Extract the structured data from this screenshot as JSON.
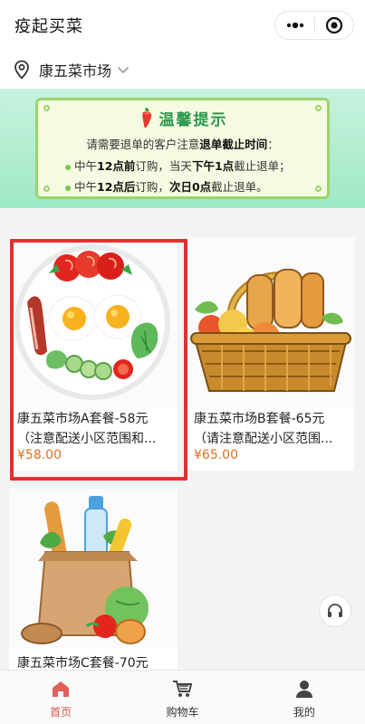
{
  "app": {
    "title": "疫起买菜"
  },
  "location": {
    "market": "康五菜市场"
  },
  "notice": {
    "title": "温馨提示",
    "line1": {
      "pre": "请需要退单的客户注意",
      "hl": "退单截止时间",
      "post": "："
    },
    "line2": {
      "a": "中午",
      "b": "12点前",
      "c": "订购，当天",
      "d": "下午1点",
      "e": "截止退单；"
    },
    "line3": {
      "a": "中午",
      "b": "12点后",
      "c": "订购，",
      "d": "次日0点",
      "e": "截止退单。"
    }
  },
  "products": [
    {
      "title": "康五菜市场A套餐-58元",
      "subtitle": "（注意配送小区范围和...",
      "price": "¥58.00"
    },
    {
      "title": "康五菜市场B套餐-65元",
      "subtitle": "（请注意配送小区范围...",
      "price": "¥65.00"
    },
    {
      "title": "康五菜市场C套餐-70元"
    }
  ],
  "tabs": [
    {
      "label": "首页",
      "icon": "home-icon",
      "active": true
    },
    {
      "label": "购物车",
      "icon": "cart-icon",
      "active": false
    },
    {
      "label": "我的",
      "icon": "user-icon",
      "active": false
    }
  ],
  "colors": {
    "accent": "#d9534f",
    "price": "#e0701e",
    "selection": "#e23030",
    "banner": "#9ee9c6"
  }
}
